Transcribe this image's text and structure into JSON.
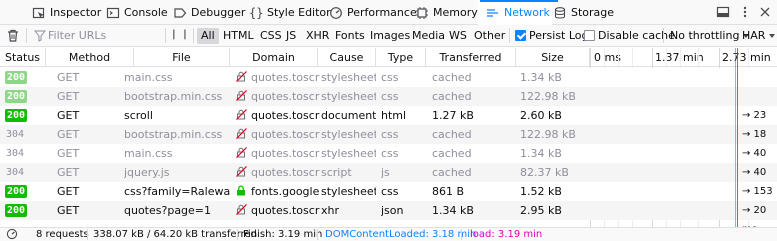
{
  "toolbox": {
    "tabs": [
      {
        "label": "Inspector",
        "icon": "inspector-icon"
      },
      {
        "label": "Console",
        "icon": "console-icon"
      },
      {
        "label": "Debugger",
        "icon": "debugger-icon"
      },
      {
        "label": "Style Editor",
        "icon": "style-editor-icon"
      },
      {
        "label": "Performance",
        "icon": "performance-icon"
      },
      {
        "label": "Memory",
        "icon": "memory-icon"
      },
      {
        "label": "Network",
        "icon": "network-icon",
        "selected": true
      },
      {
        "label": "Storage",
        "icon": "storage-icon"
      }
    ],
    "accent": "#0a84ff"
  },
  "filterbar": {
    "placeholder": "Filter URLs",
    "types": [
      "All",
      "HTML",
      "CSS",
      "JS",
      "XHR",
      "Fonts",
      "Images",
      "Media",
      "WS",
      "Other"
    ],
    "active_type": "All",
    "persist_logs": {
      "label": "Persist Logs",
      "checked": true
    },
    "disable_cache": {
      "label": "Disable cache",
      "checked": false
    },
    "throttling": "No throttling",
    "har": "HAR"
  },
  "columns": {
    "status": "Status",
    "method": "Method",
    "file": "File",
    "domain": "Domain",
    "cause": "Cause",
    "type": "Type",
    "transferred": "Transferred",
    "size": "Size",
    "wf0": "0 ms",
    "wf1": "1.37 min",
    "wf2": "2.73 min"
  },
  "requests": [
    {
      "status": "200",
      "method": "GET",
      "file": "main.css",
      "domain": "quotes.toscra...",
      "cause": "stylesheet",
      "type": "css",
      "transferred": "cached",
      "size": "1.34 kB",
      "cached": true,
      "secure": false,
      "timing": ""
    },
    {
      "status": "200",
      "method": "GET",
      "file": "bootstrap.min.css",
      "domain": "quotes.toscra...",
      "cause": "stylesheet",
      "type": "css",
      "transferred": "cached",
      "size": "122.98 kB",
      "cached": true,
      "secure": false,
      "timing": ""
    },
    {
      "status": "200",
      "method": "GET",
      "file": "scroll",
      "domain": "quotes.toscra...",
      "cause": "document",
      "type": "html",
      "transferred": "1.27 kB",
      "size": "2.60 kB",
      "cached": false,
      "secure": false,
      "timing": "→ 23 ms"
    },
    {
      "status": "304",
      "method": "GET",
      "file": "bootstrap.min.css",
      "domain": "quotes.toscra...",
      "cause": "stylesheet",
      "type": "css",
      "transferred": "cached",
      "size": "122.98 kB",
      "cached": true,
      "secure": false,
      "timing": "→ 18 ms"
    },
    {
      "status": "304",
      "method": "GET",
      "file": "main.css",
      "domain": "quotes.toscra...",
      "cause": "stylesheet",
      "type": "css",
      "transferred": "cached",
      "size": "1.34 kB",
      "cached": true,
      "secure": false,
      "timing": "→ 40 ms"
    },
    {
      "status": "304",
      "method": "GET",
      "file": "jquery.js",
      "domain": "quotes.toscra...",
      "cause": "script",
      "type": "js",
      "transferred": "cached",
      "size": "82.37 kB",
      "cached": true,
      "secure": false,
      "timing": "→ 40 ms"
    },
    {
      "status": "200",
      "method": "GET",
      "file": "css?family=Raleway:40...",
      "domain": "fonts.googlea...",
      "cause": "stylesheet",
      "type": "css",
      "transferred": "861 B",
      "size": "1.52 kB",
      "cached": false,
      "secure": true,
      "timing": "→ 153 ms"
    },
    {
      "status": "200",
      "method": "GET",
      "file": "quotes?page=1",
      "domain": "quotes.toscra...",
      "cause": "xhr",
      "type": "json",
      "transferred": "1.34 kB",
      "size": "2.95 kB",
      "cached": false,
      "secure": false,
      "timing": "→ 20 ms"
    }
  ],
  "statusbar": {
    "requests": "8 requests",
    "transferred": "338.07 kB / 64.20 kB transferred",
    "finish": "Finish: 3.19 min",
    "dcl": "DOMContentLoaded: 3.18 min",
    "load": "load: 3.19 min",
    "dcl_color": "#0a84ff",
    "load_color": "#e000c0"
  }
}
